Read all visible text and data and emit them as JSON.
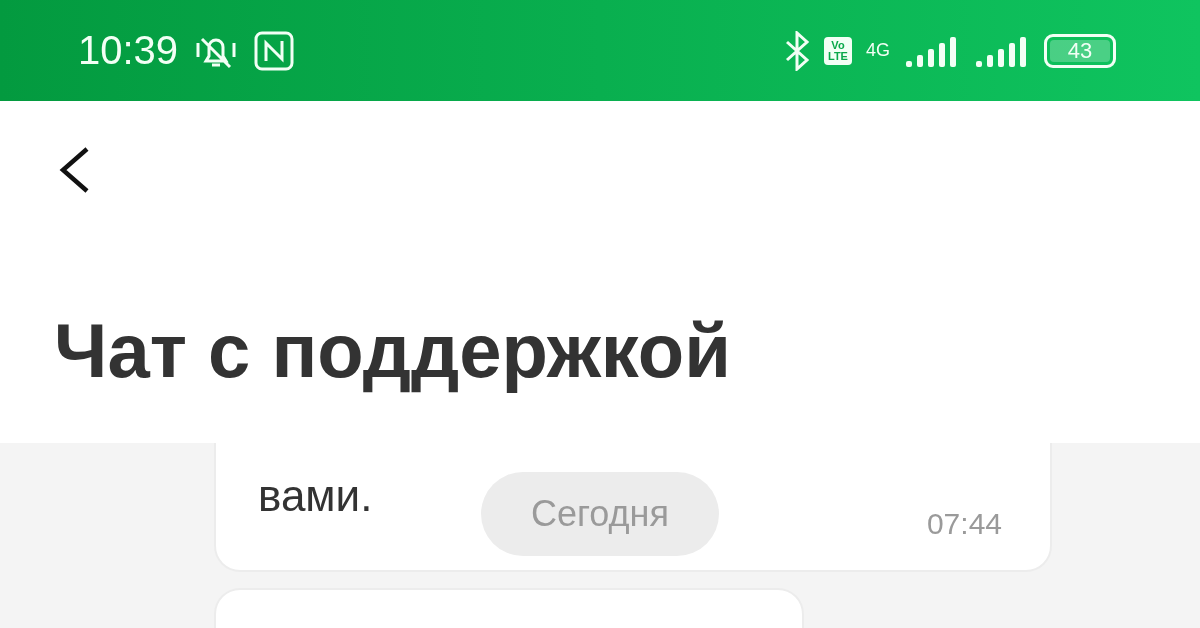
{
  "status_bar": {
    "time": "10:39",
    "network": "4G",
    "volte": "Vo\nLTE",
    "battery": "43"
  },
  "header": {
    "title": "Чат с поддержкой"
  },
  "chat": {
    "date_label": "Сегодня",
    "messages": [
      {
        "text": "вами.",
        "time": "07:44"
      }
    ]
  }
}
